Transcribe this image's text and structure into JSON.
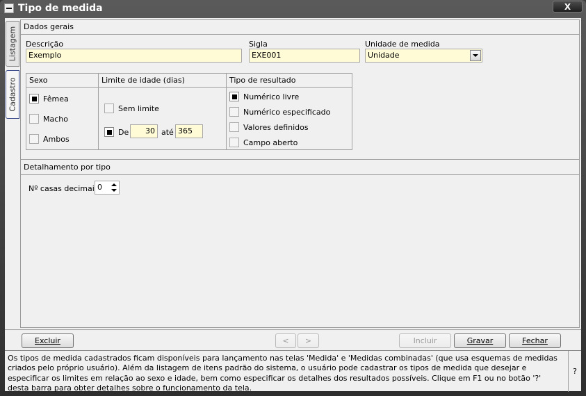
{
  "window": {
    "title": "Tipo de medida",
    "close_label": "X"
  },
  "tabs": [
    {
      "label": "Listagem"
    },
    {
      "label": "Cadastro"
    }
  ],
  "dados_gerais": {
    "header": "Dados gerais",
    "descricao_label": "Descrição",
    "descricao_value": "Exemplo",
    "sigla_label": "Sigla",
    "sigla_value": "EXE001",
    "unidade_label": "Unidade de medida",
    "unidade_value": "Unidade"
  },
  "sexo": {
    "header": "Sexo",
    "options": [
      {
        "label": "Fêmea",
        "checked": true
      },
      {
        "label": "Macho",
        "checked": false
      },
      {
        "label": "Ambos",
        "checked": false
      }
    ]
  },
  "limite_idade": {
    "header": "Limite de idade (dias)",
    "sem_limite_label": "Sem limite",
    "sem_limite_checked": false,
    "de_label": "De",
    "de_checked": true,
    "de_value": "30",
    "ate_label": "até",
    "ate_value": "365"
  },
  "tipo_resultado": {
    "header": "Tipo de resultado",
    "options": [
      {
        "label": "Numérico livre",
        "checked": true
      },
      {
        "label": "Numérico especificado",
        "checked": false
      },
      {
        "label": "Valores definidos",
        "checked": false
      },
      {
        "label": "Campo aberto",
        "checked": false
      }
    ]
  },
  "detalhamento": {
    "header": "Detalhamento por tipo",
    "casas_label": "Nº casas decimais",
    "casas_value": "0"
  },
  "buttons": {
    "excluir": "Excluir",
    "prev": "<",
    "next": ">",
    "incluir": "Incluir",
    "gravar": "Gravar",
    "fechar": "Fechar"
  },
  "help": {
    "text": "Os tipos de medida cadastrados ficam disponíveis para lançamento nas telas 'Medida' e 'Medidas combinadas' (que usa esquemas de medidas criados pelo próprio usuário). Além da listagem de itens padrão do sistema, o usuário pode cadastrar os tipos de medida que desejar e especificar os limites em relação ao sexo e idade, bem como especificar os detalhes dos resultados possíveis. Clique em F1 ou no botão '?' desta barra para obter detalhes sobre o funcionamento da tela.",
    "question_label": "?"
  }
}
